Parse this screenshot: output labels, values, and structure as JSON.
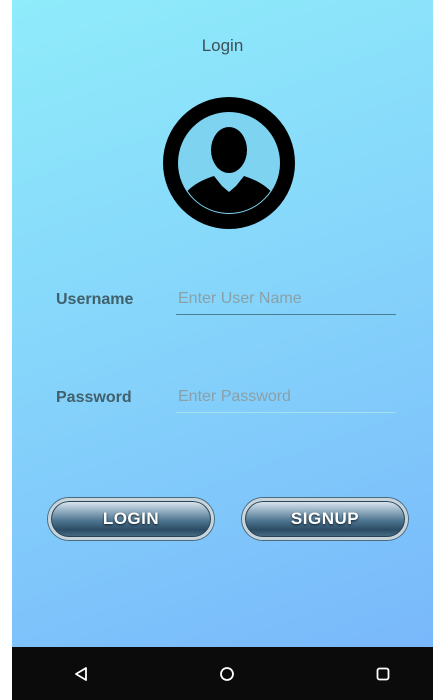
{
  "header": {
    "title": "Login"
  },
  "avatar": {
    "icon": "user-avatar-icon",
    "color": "#000000"
  },
  "form": {
    "username": {
      "label": "Username",
      "value": "",
      "placeholder": "Enter User Name"
    },
    "password": {
      "label": "Password",
      "value": "",
      "placeholder": "Enter Password"
    }
  },
  "buttons": {
    "login_label": "LOGIN",
    "signup_label": "SIGNUP"
  },
  "navigation": {
    "back_icon": "back-triangle-icon",
    "home_icon": "home-circle-icon",
    "recents_icon": "recents-square-icon"
  },
  "colors": {
    "background_start": "#8fecfa",
    "background_end": "#79b8fb",
    "nav_bar": "#0b0b0b"
  }
}
